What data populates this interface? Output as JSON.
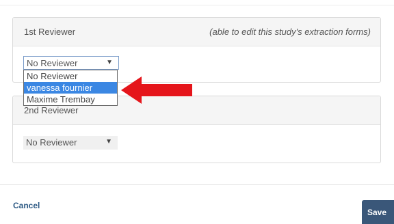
{
  "panel1": {
    "title": "1st Reviewer",
    "note": "(able to edit this study's extraction forms)",
    "select_value": "No Reviewer",
    "options": [
      "No Reviewer",
      "vanessa fournier",
      "Maxime Trembay"
    ],
    "highlighted_option": "vanessa fournier"
  },
  "panel2": {
    "title": "2nd Reviewer",
    "select_value": "No Reviewer"
  },
  "footer": {
    "cancel_label": "Cancel",
    "save_label": "Save"
  },
  "colors": {
    "highlight": "#3b87e3",
    "arrow": "#e5151b",
    "save_button": "#3a5779",
    "link": "#2f5b85"
  },
  "icons": {
    "caret": "caret-down-icon",
    "arrow": "red-arrow-left-icon"
  }
}
